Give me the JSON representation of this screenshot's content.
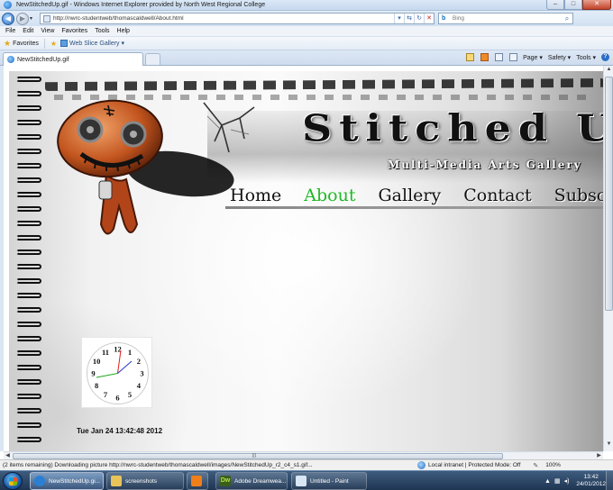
{
  "window": {
    "title": "NewStitchedUp.gif - Windows Internet Explorer provided by North West Regional College",
    "controls": {
      "minimize": "–",
      "maximize": "□",
      "close": "✕"
    }
  },
  "address": {
    "url": "http://nwrc-studentweb/thomascaldwell/About.html",
    "search_placeholder": "Bing"
  },
  "menu": [
    "File",
    "Edit",
    "View",
    "Favorites",
    "Tools",
    "Help"
  ],
  "favorites": {
    "label": "Favorites",
    "web_slice": "Web Slice Gallery ▾"
  },
  "tab": {
    "label": "NewStitchedUp.gif"
  },
  "commands": [
    "Page ▾",
    "Safety ▾",
    "Tools ▾"
  ],
  "page": {
    "site_title": "Stitched U",
    "site_subtitle": "Multi-Media Arts Gallery",
    "nav": [
      "Home",
      "About",
      "Gallery",
      "Contact",
      "Subscribe"
    ],
    "nav_active": "About",
    "clock_numbers": [
      "12",
      "1",
      "2",
      "3",
      "4",
      "5",
      "6",
      "7",
      "8",
      "9",
      "10",
      "11"
    ],
    "date_text": "Tue Jan 24 13:42:48 2012"
  },
  "status": {
    "text": "(2 items remaining) Downloading picture http://nwrc-studentweb/thomascaldwell/images/NewStitchedUp_r2_c4_s1.gif...",
    "zone": "Local intranet | Protected Mode: Off",
    "zoom": "100%"
  },
  "taskbar": {
    "items": [
      {
        "label": "NewStitchedUp.gi...",
        "color": "#2a7fd4"
      },
      {
        "label": "screenshots",
        "color": "#e8c35a"
      },
      {
        "label": "",
        "color": "#f07f1a"
      },
      {
        "label": "Adobe Dreamwea...",
        "color": "#3a5e1a"
      },
      {
        "label": "Untitled - Paint",
        "color": "#d9e6f3"
      }
    ],
    "dw_icon": "Dw",
    "time": "13:42",
    "date": "24/01/2012"
  },
  "colors": {
    "nav_active": "#1db824",
    "accent": "#2d6fc6"
  }
}
